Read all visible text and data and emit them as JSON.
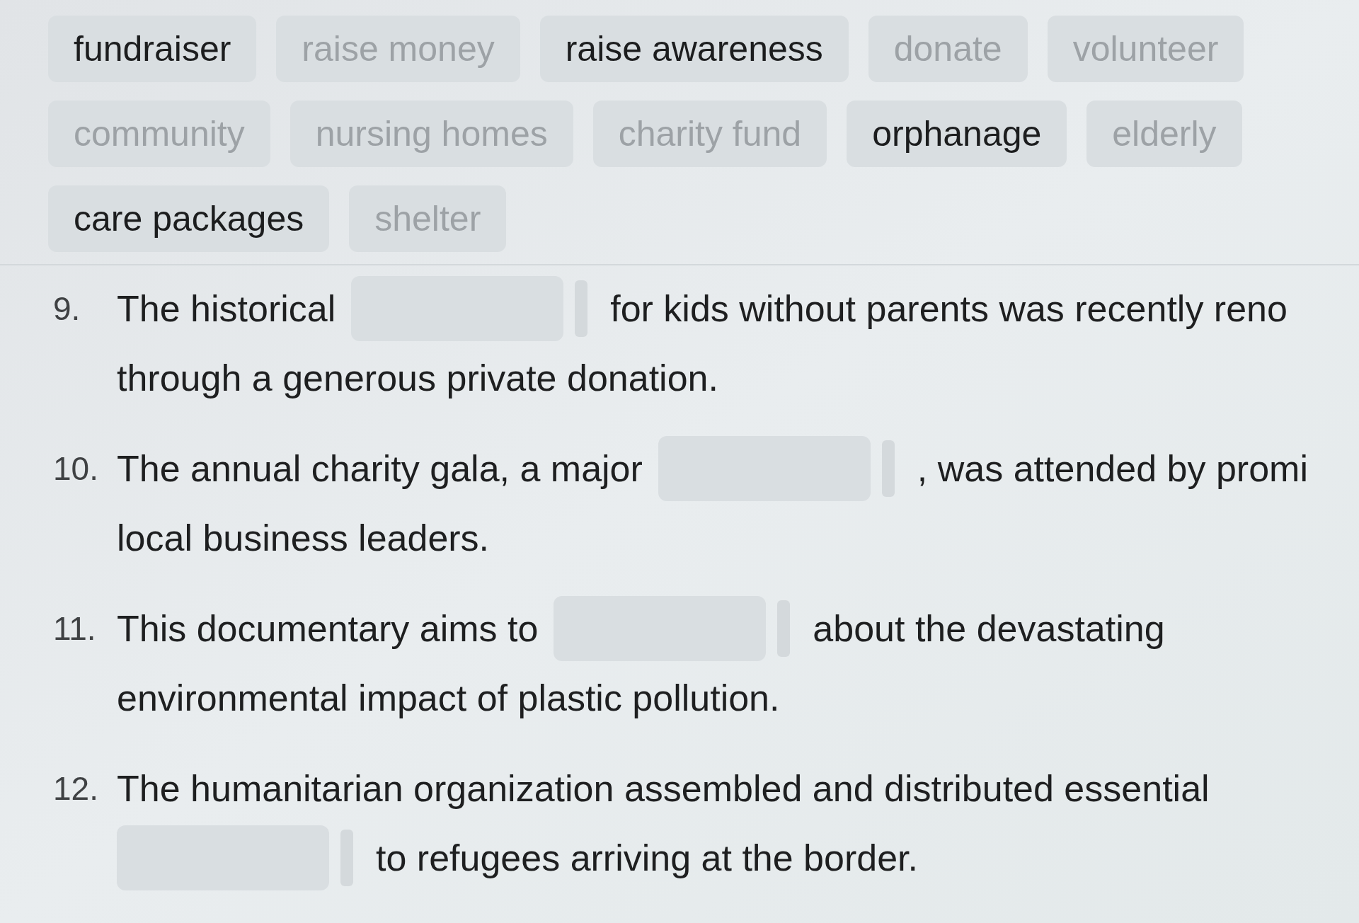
{
  "word_bank": [
    {
      "text": "fundraiser",
      "used": false
    },
    {
      "text": "raise money",
      "used": true
    },
    {
      "text": "raise awareness",
      "used": false
    },
    {
      "text": "donate",
      "used": true
    },
    {
      "text": "volunteer",
      "used": true
    },
    {
      "text": "community",
      "used": true
    },
    {
      "text": "nursing homes",
      "used": true
    },
    {
      "text": "charity fund",
      "used": true
    },
    {
      "text": "orphanage",
      "used": false
    },
    {
      "text": "elderly",
      "used": true
    },
    {
      "text": "care packages",
      "used": false
    },
    {
      "text": "shelter",
      "used": true
    }
  ],
  "questions": [
    {
      "number": "9.",
      "lines": [
        [
          {
            "kind": "text",
            "text": "The historical"
          },
          {
            "kind": "blank"
          },
          {
            "kind": "text",
            "text": "for kids without parents was recently reno"
          }
        ],
        [
          {
            "kind": "text",
            "text": "through a generous private donation."
          }
        ]
      ]
    },
    {
      "number": "10.",
      "lines": [
        [
          {
            "kind": "text",
            "text": "The annual charity gala, a major"
          },
          {
            "kind": "blank"
          },
          {
            "kind": "text",
            "text": ", was attended by promi"
          }
        ],
        [
          {
            "kind": "text",
            "text": "local business leaders."
          }
        ]
      ]
    },
    {
      "number": "11.",
      "lines": [
        [
          {
            "kind": "text",
            "text": "This documentary aims to"
          },
          {
            "kind": "blank"
          },
          {
            "kind": "text",
            "text": "about the devastating"
          }
        ],
        [
          {
            "kind": "text",
            "text": "environmental impact of plastic pollution."
          }
        ]
      ]
    },
    {
      "number": "12.",
      "lines": [
        [
          {
            "kind": "text",
            "text": "The humanitarian organization assembled and distributed essential"
          }
        ],
        [
          {
            "kind": "blank"
          },
          {
            "kind": "text",
            "text": "to refugees arriving at the border."
          }
        ]
      ]
    }
  ]
}
